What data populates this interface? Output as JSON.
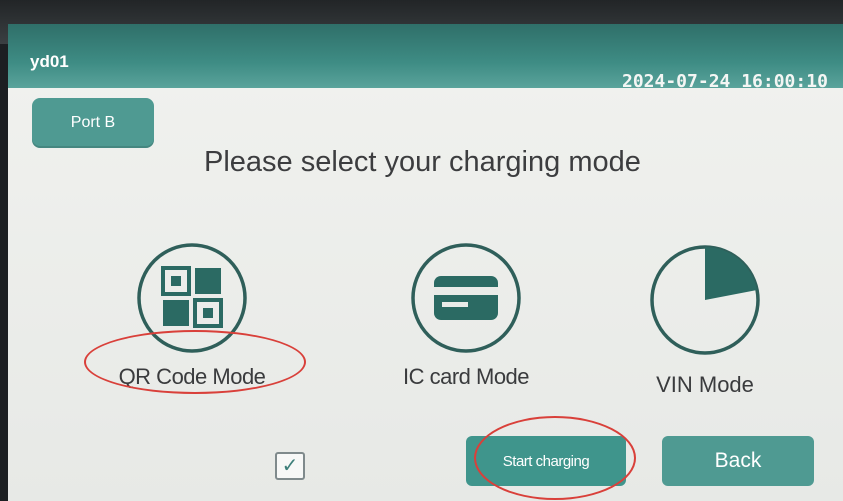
{
  "status_bar": {
    "device_id": "yd01",
    "datetime": "2024-07-24 16:00:10"
  },
  "port": {
    "label": "Port B"
  },
  "heading": "Please select your charging mode",
  "modes": [
    {
      "label": "QR Code Mode",
      "icon": "qr-code-icon",
      "highlighted": true
    },
    {
      "label": "IC card Mode",
      "icon": "card-icon",
      "highlighted": false
    },
    {
      "label": "VIN Mode",
      "icon": "pie-icon",
      "highlighted": false
    }
  ],
  "footer": {
    "checkbox_checked": true,
    "start_label": "Start charging",
    "back_label": "Back"
  },
  "colors": {
    "accent": "#4f9a92",
    "status_bar": "#3e8c84",
    "icon_dark": "#2b6a63",
    "highlight": "#d9403a"
  }
}
